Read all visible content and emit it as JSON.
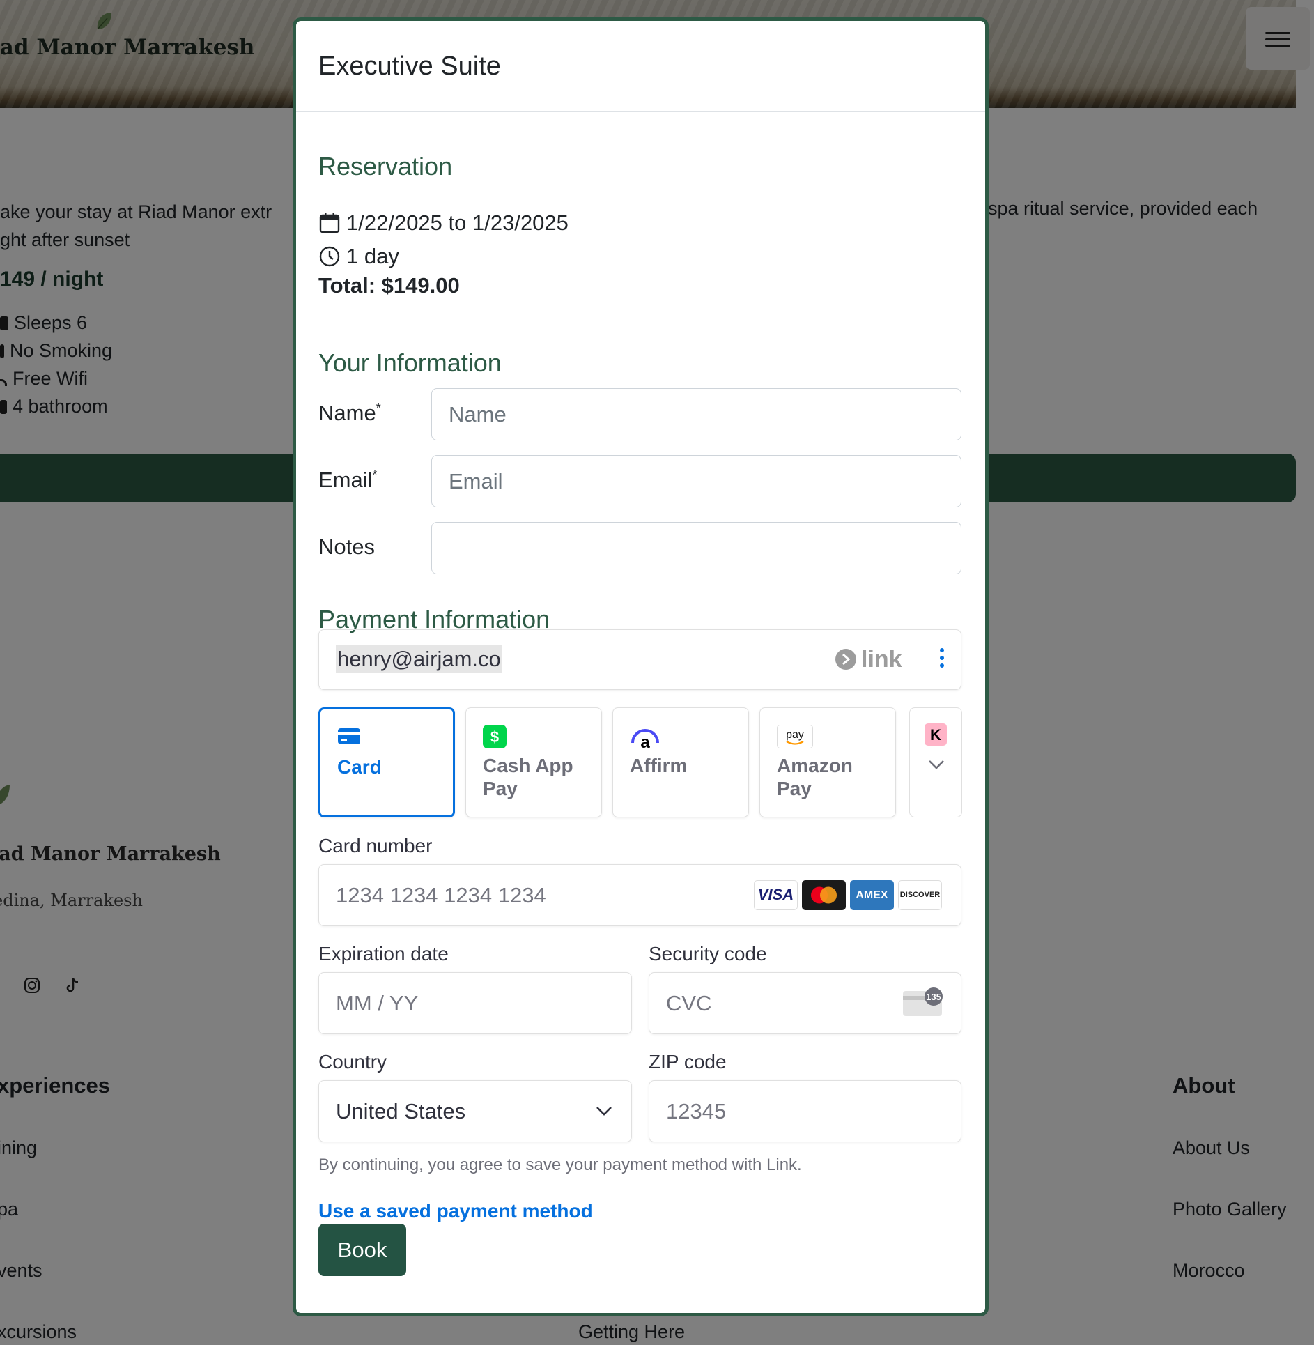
{
  "background": {
    "site_name": "iad Manor Marrakesh",
    "description_left_1": "ake your stay at Riad Manor extr",
    "description_left_2": "ght after sunset",
    "description_right": "spa ritual service, provided each",
    "price": "149 / night",
    "amenities": [
      "Sleeps 6",
      "No Smoking",
      "Free Wifi",
      "4 bathroom"
    ],
    "footer": {
      "name": "iad Manor Marrakesh",
      "location": "edina, Marrakesh",
      "experiences_heading": "xperiences",
      "experiences_links": [
        "ining",
        "pa",
        "vents",
        "xcursions"
      ],
      "middle_link": "Getting Here",
      "about_heading": "About",
      "about_links": [
        "About Us",
        "Photo Gallery",
        "Morocco"
      ]
    }
  },
  "modal": {
    "title": "Executive Suite",
    "reservation": {
      "heading": "Reservation",
      "dates": "1/22/2025 to 1/23/2025",
      "duration": "1 day",
      "total": "Total: $149.00"
    },
    "your_info": {
      "heading": "Your Information",
      "name_label": "Name",
      "name_placeholder": "Name",
      "email_label": "Email",
      "email_placeholder": "Email",
      "notes_label": "Notes",
      "required_mark": "*"
    },
    "payment": {
      "heading": "Payment Information",
      "link_email": "henry@airjam.co",
      "link_brand": "link",
      "methods": [
        {
          "label": "Card",
          "selected": true
        },
        {
          "label": "Cash App Pay",
          "selected": false
        },
        {
          "label": "Affirm",
          "selected": false
        },
        {
          "label": "Amazon Pay",
          "selected": false
        }
      ],
      "amazon_icon_text": "pay",
      "klarna_icon_text": "K",
      "card_number_label": "Card number",
      "card_number_placeholder": "1234 1234 1234 1234",
      "card_brands": [
        "VISA",
        "Mastercard",
        "AMEX",
        "DISCOVER"
      ],
      "expiration_label": "Expiration date",
      "expiration_placeholder": "MM / YY",
      "security_label": "Security code",
      "security_placeholder": "CVC",
      "cvc_icon_text": "135",
      "country_label": "Country",
      "country_value": "United States",
      "zip_label": "ZIP code",
      "zip_placeholder": "12345",
      "terms": "By continuing, you agree to save your payment method with Link.",
      "saved_method_link": "Use a saved payment method"
    },
    "book_button": "Book"
  },
  "colors": {
    "brand_green": "#2d5a45",
    "stripe_blue": "#0570de",
    "book_button": "#245343"
  }
}
